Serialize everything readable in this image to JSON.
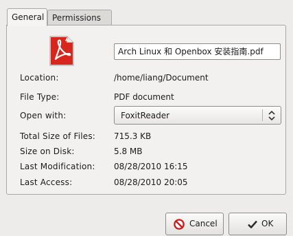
{
  "tabs": {
    "general": "General",
    "permissions": "Permissions"
  },
  "file": {
    "name": "Arch Linux 和 Openbox 安装指南.pdf",
    "icon": "pdf-file-icon"
  },
  "labels": {
    "location": "Location:",
    "file_type": "File Type:",
    "open_with": "Open with:",
    "total_size": "Total Size of Files:",
    "size_on_disk": "Size on Disk:",
    "last_modification": "Last Modification:",
    "last_access": "Last Access:"
  },
  "values": {
    "location": "/home/liang/Document",
    "file_type": "PDF document",
    "open_with": "FoxitReader",
    "total_size": "715.3 KB",
    "size_on_disk": "5.8 MB",
    "last_modification": "08/28/2010 16:15",
    "last_access": "08/28/2010 20:05"
  },
  "buttons": {
    "cancel": "Cancel",
    "ok": "OK"
  },
  "colors": {
    "pdf_red": "#d7261d",
    "cancel_red": "#cc1e1e",
    "ok_check": "#2b2b2b"
  }
}
